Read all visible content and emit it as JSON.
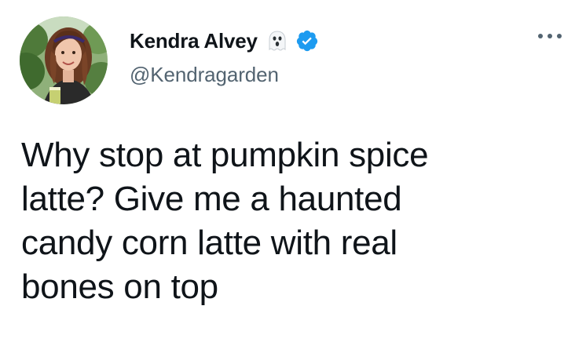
{
  "author": {
    "display_name": "Kendra Alvey",
    "handle": "@Kendragarden",
    "badges": [
      "ghost-emoji-icon",
      "verified-badge-icon"
    ],
    "verified_color": "#1d9bf0"
  },
  "tweet": {
    "text": "Why stop at pumpkin spice\nlatte? Give me a haunted\ncandy corn latte with real\nbones on top"
  },
  "menu": {
    "icon": "more-options-icon"
  },
  "colors": {
    "text_primary": "#0f1419",
    "text_secondary": "#536471",
    "background": "#ffffff"
  }
}
